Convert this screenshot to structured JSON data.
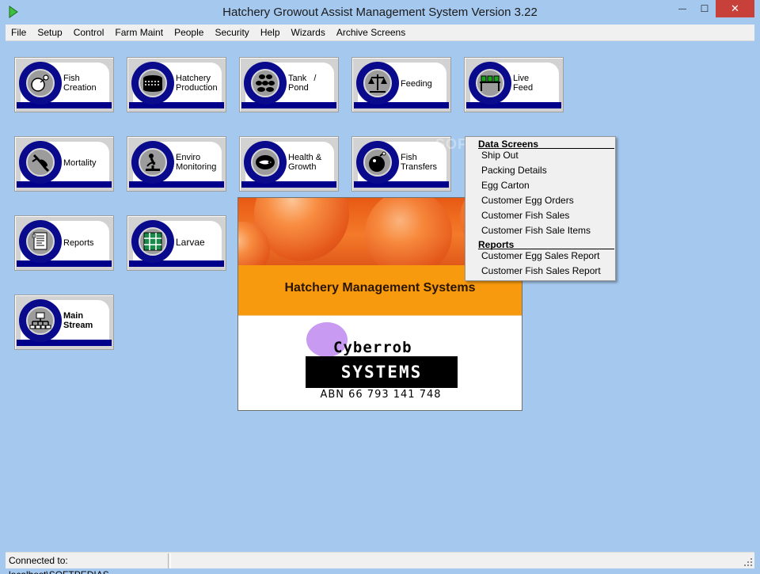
{
  "window": {
    "title": "Hatchery Growout Assist Management System Version 3.22",
    "min_glyph": "—",
    "max_glyph": "☐",
    "close_glyph": "✕"
  },
  "menubar": [
    "File",
    "Setup",
    "Control",
    "Farm Maint",
    "People",
    "Security",
    "Help",
    "Wizards",
    "Archive Screens"
  ],
  "tiles": {
    "fish_creation": [
      "Fish",
      "Creation"
    ],
    "hatchery_production": [
      "Hatchery",
      "Production"
    ],
    "tank_pond": [
      "Tank   /",
      "Pond"
    ],
    "feeding": [
      "Feeding"
    ],
    "live_feed": [
      "Live",
      "Feed"
    ],
    "mortality": [
      "Mortality"
    ],
    "enviro_monitoring": [
      "Enviro",
      "Monitoring"
    ],
    "health_growth": [
      "Health &",
      "Growth"
    ],
    "fish_transfers": [
      "Fish",
      "Transfers"
    ],
    "reports": [
      "Reports"
    ],
    "larvae": [
      "Larvae"
    ],
    "main_stream": [
      "Main",
      "Stream"
    ]
  },
  "splash": {
    "title": "Hatchery Management Systems",
    "company_top": "Cyberrob",
    "company_bottom": "SYSTEMS",
    "abn": "ABN 66 793 141 748"
  },
  "dropdown": {
    "data_header": "Data Screens",
    "data_items": [
      "Ship Out",
      "Packing Details",
      "Egg Carton",
      "Customer Egg Orders",
      "Customer Fish Sales",
      "Customer Fish Sale Items"
    ],
    "reports_header": "Reports",
    "report_items": [
      "Customer Egg Sales Report",
      "Customer Fish Sales Report"
    ]
  },
  "watermark": "SOFT",
  "status": {
    "connection": "Connected to: localhost\\SOFTPEDIAS"
  },
  "colors": {
    "background": "#a5c8ee",
    "tile_strip": "#00008b",
    "close_button": "#c7403a",
    "splash_band": "#f89a0d"
  }
}
